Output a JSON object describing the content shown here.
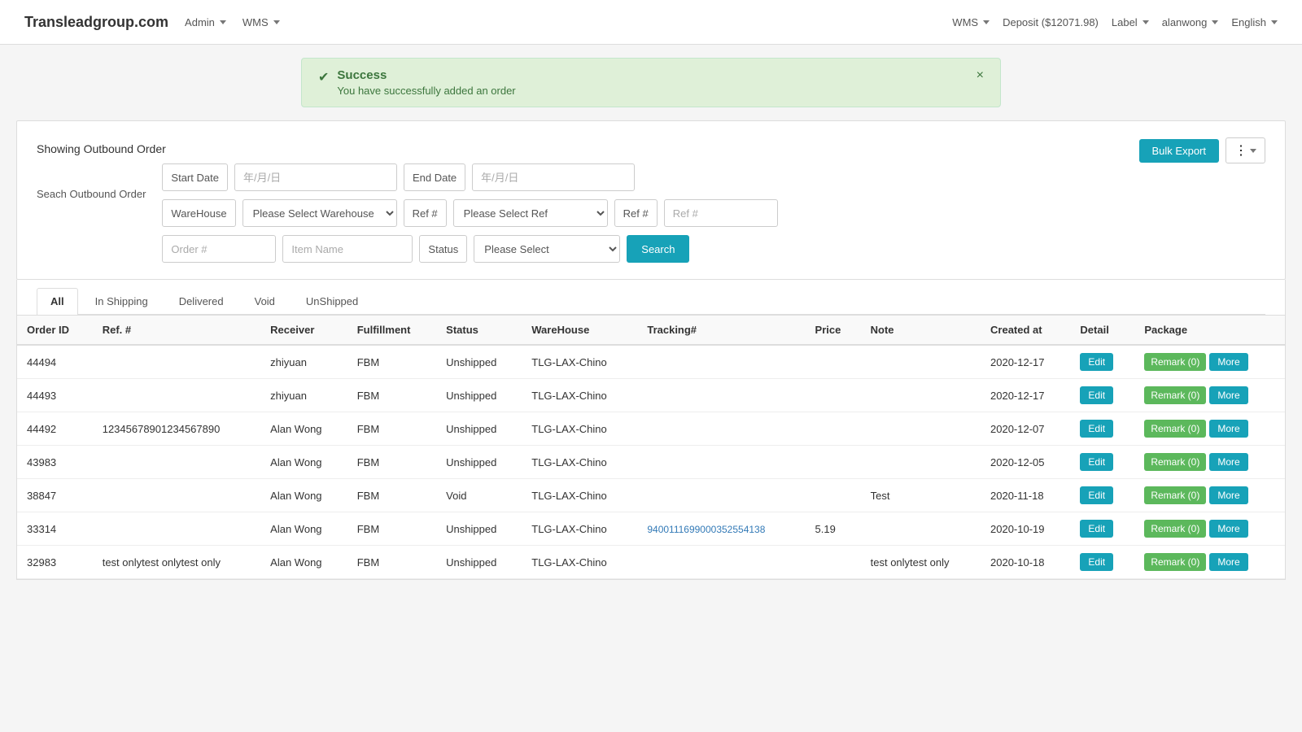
{
  "navbar": {
    "brand": "Transleadgroup.com",
    "left_links": [
      {
        "label": "Admin",
        "id": "admin"
      },
      {
        "label": "WMS",
        "id": "wms"
      }
    ],
    "right_links": [
      {
        "label": "WMS",
        "id": "wms-right"
      },
      {
        "label": "Deposit ($12071.98)",
        "id": "deposit"
      },
      {
        "label": "Label",
        "id": "label"
      },
      {
        "label": "alanwong",
        "id": "user"
      },
      {
        "label": "English",
        "id": "lang"
      }
    ]
  },
  "alert": {
    "title": "Success",
    "body": "You have successfully added an order",
    "close": "×"
  },
  "panel": {
    "showing_label": "Showing Outbound Order",
    "bulk_export_label": "Bulk Export",
    "dots_icon": "⋮"
  },
  "search": {
    "label": "Seach Outbound Order",
    "start_date_label": "Start Date",
    "start_date_placeholder": "年/月/日",
    "end_date_label": "End Date",
    "end_date_placeholder": "年/月/日",
    "warehouse_label": "WareHouse",
    "warehouse_placeholder": "Please Select Warehouse",
    "ref_label1": "Ref #",
    "ref_placeholder": "Please Select Ref",
    "ref_label2": "Ref #",
    "ref_placeholder2": "Ref #",
    "order_placeholder": "Order #",
    "item_name_placeholder": "Item Name",
    "status_label": "Status",
    "status_placeholder": "Please Select",
    "search_btn": "Search"
  },
  "tabs": [
    {
      "label": "All",
      "active": true,
      "id": "all"
    },
    {
      "label": "In Shipping",
      "active": false,
      "id": "in-shipping"
    },
    {
      "label": "Delivered",
      "active": false,
      "id": "delivered"
    },
    {
      "label": "Void",
      "active": false,
      "id": "void"
    },
    {
      "label": "UnShipped",
      "active": false,
      "id": "unshipped"
    }
  ],
  "table": {
    "headers": [
      "Order ID",
      "Ref. #",
      "Receiver",
      "Fulfillment",
      "Status",
      "WareHouse",
      "Tracking#",
      "Price",
      "Note",
      "Created at",
      "Detail",
      "Package"
    ],
    "rows": [
      {
        "order_id": "44494",
        "ref": "",
        "receiver": "zhiyuan",
        "fulfillment": "FBM",
        "status": "Unshipped",
        "warehouse": "TLG-LAX-Chino",
        "tracking": "",
        "price": "",
        "note": "",
        "created_at": "2020-12-17",
        "remark_count": "0"
      },
      {
        "order_id": "44493",
        "ref": "",
        "receiver": "zhiyuan",
        "fulfillment": "FBM",
        "status": "Unshipped",
        "warehouse": "TLG-LAX-Chino",
        "tracking": "",
        "price": "",
        "note": "",
        "created_at": "2020-12-17",
        "remark_count": "0"
      },
      {
        "order_id": "44492",
        "ref": "12345678901234567890",
        "receiver": "Alan Wong",
        "fulfillment": "FBM",
        "status": "Unshipped",
        "warehouse": "TLG-LAX-Chino",
        "tracking": "",
        "price": "",
        "note": "",
        "created_at": "2020-12-07",
        "remark_count": "0"
      },
      {
        "order_id": "43983",
        "ref": "",
        "receiver": "Alan Wong",
        "fulfillment": "FBM",
        "status": "Unshipped",
        "warehouse": "TLG-LAX-Chino",
        "tracking": "",
        "price": "",
        "note": "",
        "created_at": "2020-12-05",
        "remark_count": "0"
      },
      {
        "order_id": "38847",
        "ref": "",
        "receiver": "Alan Wong",
        "fulfillment": "FBM",
        "status": "Void",
        "warehouse": "TLG-LAX-Chino",
        "tracking": "",
        "price": "",
        "note": "Test",
        "created_at": "2020-11-18",
        "remark_count": "0"
      },
      {
        "order_id": "33314",
        "ref": "",
        "receiver": "Alan Wong",
        "fulfillment": "FBM",
        "status": "Unshipped",
        "warehouse": "TLG-LAX-Chino",
        "tracking": "9400111699000352554138",
        "price": "5.19",
        "note": "",
        "created_at": "2020-10-19",
        "remark_count": "0"
      },
      {
        "order_id": "32983",
        "ref": "test onlytest onlytest only",
        "receiver": "Alan Wong",
        "fulfillment": "FBM",
        "status": "Unshipped",
        "warehouse": "TLG-LAX-Chino",
        "tracking": "",
        "price": "",
        "note": "test onlytest only",
        "created_at": "2020-10-18",
        "remark_count": "0"
      }
    ],
    "btn_edit": "Edit",
    "btn_remark_prefix": "Remark (",
    "btn_remark_suffix": ")",
    "btn_more": "More"
  }
}
